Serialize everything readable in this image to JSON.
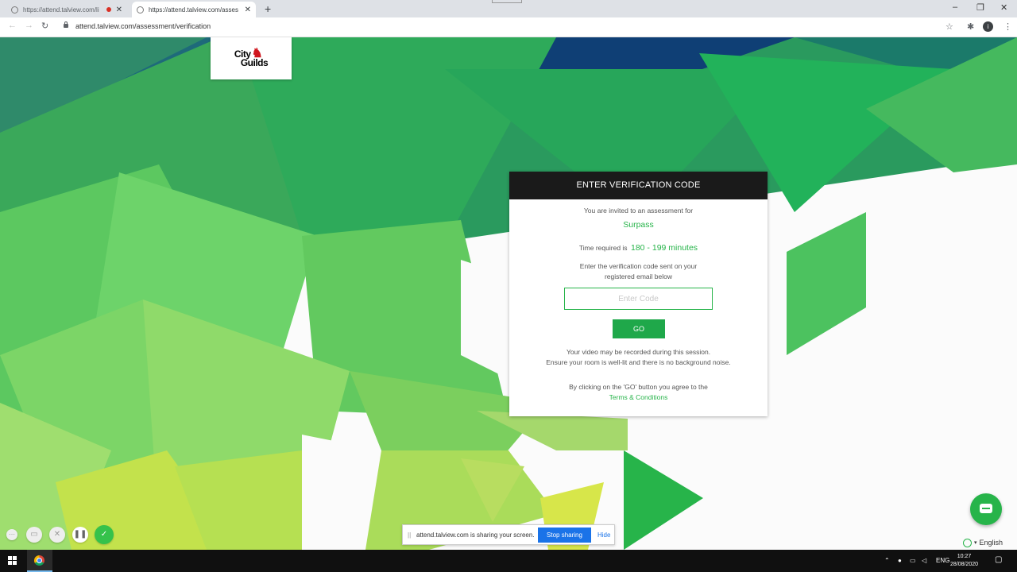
{
  "browser": {
    "tabs": [
      {
        "title": "https://attend.talview.com/li"
      },
      {
        "title": "https://attend.talview.com/asses"
      }
    ],
    "new_tab": "+",
    "url": "attend.talview.com/assessment/verification",
    "profile_initial": "i",
    "window_controls": {
      "minimize": "–",
      "restore": "❐",
      "close": "✕"
    }
  },
  "logo": {
    "line1": "City",
    "line2": "Guilds",
    "brand": "City & Guilds"
  },
  "card": {
    "header": "ENTER VERIFICATION CODE",
    "invited_text": "You are invited to an assessment for",
    "assessment_name": "Surpass",
    "time_prefix": "Time required is",
    "time_value": "180 - 199 minutes",
    "instruction_line1": "Enter the verification code sent on your",
    "instruction_line2": "registered email below",
    "code_placeholder": "Enter Code",
    "go_label": "GO",
    "video_line1": "Your video may be recorded during this session.",
    "video_line2": "Ensure your room is well-lit and there is no background noise.",
    "terms_prefix": "By clicking on the 'GO' button you agree to the",
    "terms_link": "Terms & Conditions"
  },
  "share_bar": {
    "grip": "||",
    "message": "attend.talview.com is sharing your screen.",
    "stop_label": "Stop sharing",
    "hide_label": "Hide"
  },
  "language": {
    "label": "English"
  },
  "taskbar": {
    "tray_lang": "ENG",
    "time": "10:27",
    "date": "28/08/2020"
  },
  "colors": {
    "accent_green": "#27b44a",
    "header_dark": "#1a1a1a",
    "share_blue": "#1a73e8"
  }
}
